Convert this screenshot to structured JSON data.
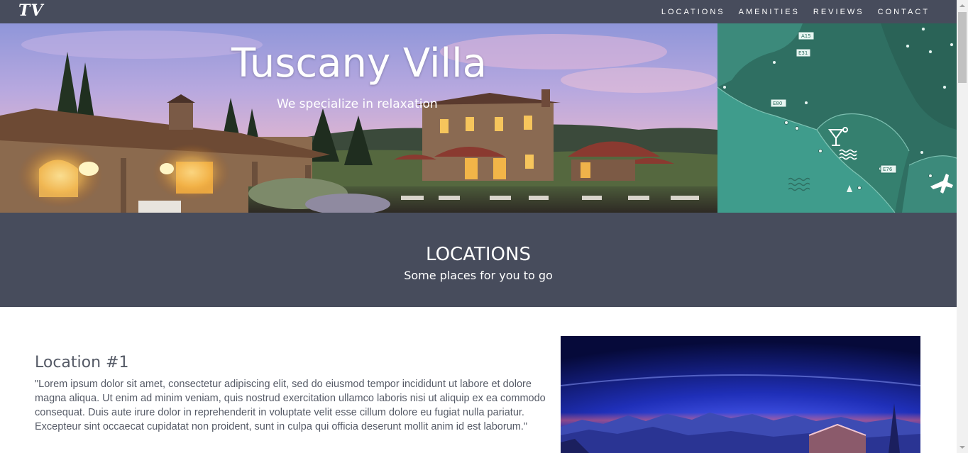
{
  "brand": "TV",
  "nav": {
    "locations": "LOCATIONS",
    "amenities": "AMENITIES",
    "reviews": "REVIEWS",
    "contact": "CONTACT"
  },
  "hero": {
    "title": "Tuscany Villa",
    "subtitle": "We specialize in relaxation"
  },
  "map_labels": [
    "A15",
    "E31",
    "E80",
    "E76"
  ],
  "section": {
    "title": "LOCATIONS",
    "subtitle": "Some places for you to go"
  },
  "location": {
    "heading": "Location #1",
    "text": "\"Lorem ipsum dolor sit amet, consectetur adipiscing elit, sed do eiusmod tempor incididunt ut labore et dolore magna aliqua. Ut enim ad minim veniam, quis nostrud exercitation ullamco laboris nisi ut aliquip ex ea commodo consequat. Duis aute irure dolor in reprehenderit in voluptate velit esse cillum dolore eu fugiat nulla pariatur. Excepteur sint occaecat cupidatat non proident, sunt in culpa qui officia deserunt mollit anim id est laborum.\""
  },
  "colors": {
    "nav_bg": "#474c5c",
    "map_teal": "#3f9c8c",
    "text_body": "#555a66"
  }
}
